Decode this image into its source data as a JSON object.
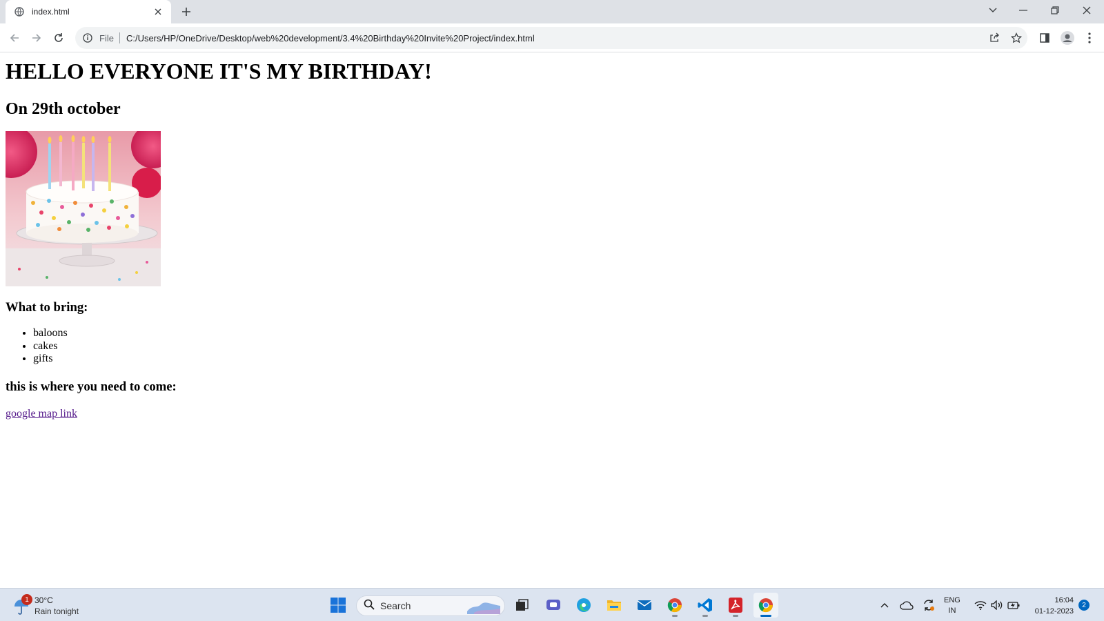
{
  "browser": {
    "tab": {
      "title": "index.html"
    },
    "address": {
      "scheme": "File",
      "url": "C:/Users/HP/OneDrive/Desktop/web%20development/3.4%20Birthday%20Invite%20Project/index.html"
    }
  },
  "page": {
    "heading": "HELLO EVERYONE IT'S MY BIRTHDAY!",
    "date": "On 29th october",
    "image": {
      "alt": "cake-image"
    },
    "bring_heading": "What to bring:",
    "bring_items": [
      "baloons",
      "cakes",
      "gifts"
    ],
    "come_heading": "this is where you need to come:",
    "map_link": "google map link"
  },
  "taskbar": {
    "weather": {
      "badge": "1",
      "temp": "30°C",
      "desc": "Rain tonight"
    },
    "search": {
      "placeholder": "Search"
    },
    "apps": [
      "start",
      "search",
      "task-view",
      "teams",
      "edge",
      "file-explorer",
      "mail",
      "chrome",
      "vscode",
      "acrobat",
      "chrome-active"
    ],
    "language": {
      "line1": "ENG",
      "line2": "IN"
    },
    "clock": {
      "time": "16:04",
      "date": "01-12-2023"
    },
    "notifications": "2"
  },
  "colors": {
    "link_visited": "#551a8b",
    "taskbar": "#dce4f0",
    "tabstrip": "#dee1e6"
  }
}
